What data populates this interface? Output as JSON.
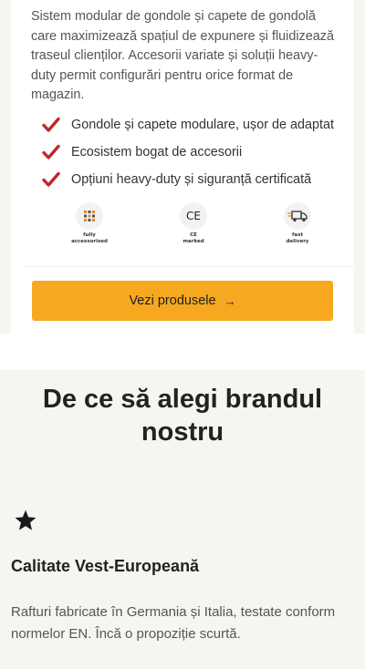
{
  "product_card": {
    "description": "Sistem modular de gondole și capete de gondolă care maximizează spațiul de expunere și fluidizează traseul clienților. Accesorii variate și soluții heavy-duty permit configurări pentru orice format de magazin.",
    "features": [
      {
        "icon": "check-icon",
        "label": "Gondole și capete modulare, ușor de adaptat"
      },
      {
        "icon": "check-icon",
        "label": "Ecosistem bogat de accesorii"
      },
      {
        "icon": "check-icon",
        "label": "Opțiuni heavy-duty și siguranță certificată"
      }
    ],
    "badges": [
      {
        "icon": "accessories-grid-icon",
        "label_line1": "fully",
        "label_line2": "accessorised"
      },
      {
        "icon": "ce-mark-icon",
        "glyph": "CE",
        "label_line1": "CE",
        "label_line2": "marked"
      },
      {
        "icon": "delivery-truck-icon",
        "label_line1": "fast",
        "label_line2": "delivery"
      }
    ],
    "cta": {
      "label": "Vezi produsele",
      "arrow": "→"
    }
  },
  "why_section": {
    "title_line1": "De ce să alegi brandul",
    "title_line2": "nostru",
    "item": {
      "icon": "star-icon",
      "title": "Calitate Vest-Europeană",
      "description": "Rafturi fabricate în Germania și Italia, testate conform normelor EN. Încă o propoziție scurtă."
    }
  },
  "colors": {
    "accent": "#f6a821",
    "check": "#c0272d",
    "background": "#f6f5f1",
    "card": "#ffffff"
  }
}
